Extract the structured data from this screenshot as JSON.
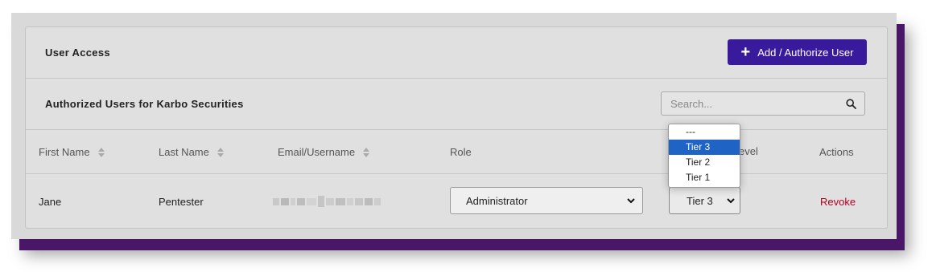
{
  "header": {
    "title": "User Access",
    "add_button": "Add / Authorize User"
  },
  "section": {
    "title": "Authorized Users for Karbo Securities"
  },
  "search": {
    "placeholder": "Search..."
  },
  "table": {
    "columns": [
      "First Name",
      "Last Name",
      "Email/Username",
      "Role",
      "Tier Level",
      "Actions"
    ],
    "rows": [
      {
        "first_name": "Jane",
        "last_name": "Pentester",
        "email": "",
        "role": "Administrator",
        "tier": "Tier 3",
        "action": "Revoke"
      }
    ]
  },
  "tier_dropdown": {
    "options": [
      "---",
      "Tier 3",
      "Tier 2",
      "Tier 1"
    ],
    "highlighted": "Tier 3"
  },
  "colors": {
    "accent": "#3a1a9c",
    "revoke": "#b00020",
    "highlight": "#1f63c4",
    "frame_shadow": "#4a1668"
  },
  "icons": {
    "add": "plus-icon",
    "search": "search-icon",
    "sort": "sort-icon",
    "select": "chevron-down-icon"
  }
}
